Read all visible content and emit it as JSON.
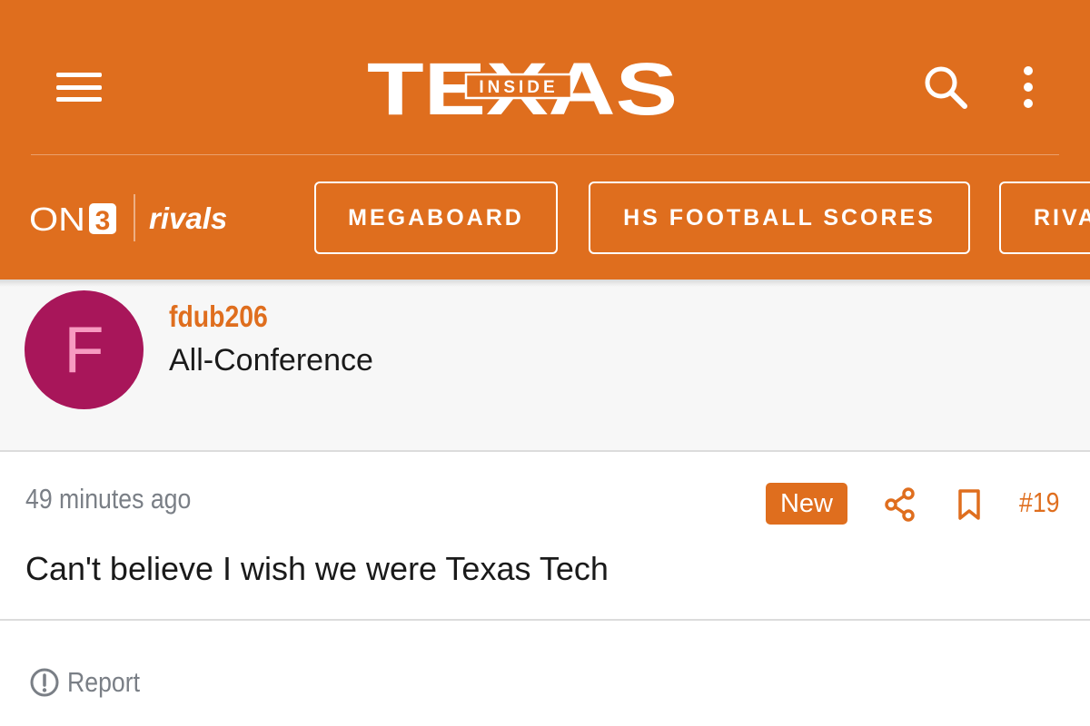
{
  "header": {
    "logo_main": "TEXAS",
    "logo_tag": "INSIDE",
    "brand_on3": "ON3",
    "brand_rivals": "rivals",
    "nav": [
      {
        "label": "MEGABOARD"
      },
      {
        "label": "HS FOOTBALL SCORES"
      },
      {
        "label": "RIVA"
      }
    ],
    "colors": {
      "accent": "#df6e1e"
    }
  },
  "author": {
    "initial": "F",
    "username": "fdub206",
    "rank": "All-Conference",
    "avatar_color": "#a8165a"
  },
  "post": {
    "time": "49 minutes ago",
    "badge": "New",
    "number": "#19",
    "body": "Can't believe I wish we were Texas Tech",
    "icons": [
      "share-icon",
      "bookmark-icon"
    ]
  },
  "footer": {
    "report_label": "Report"
  }
}
